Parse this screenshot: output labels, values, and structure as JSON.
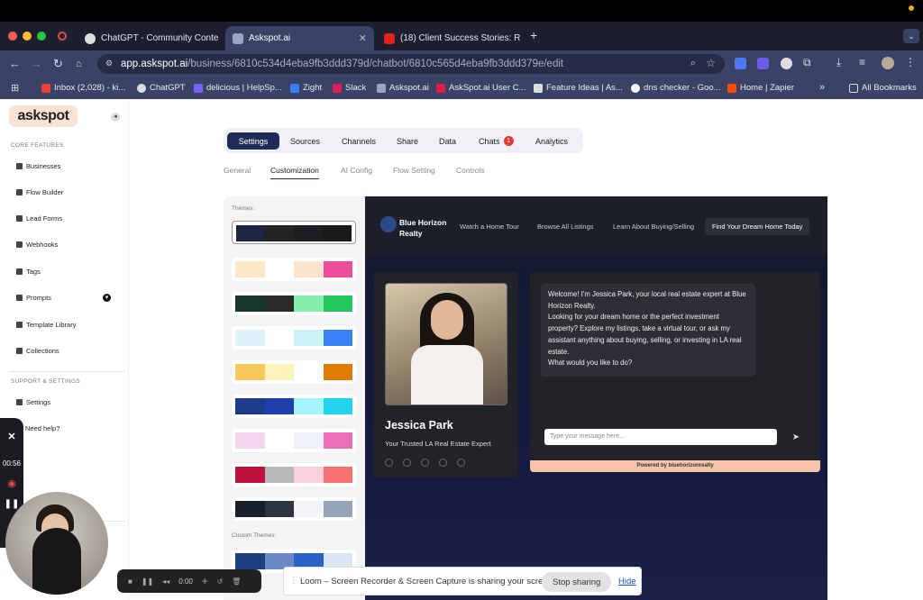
{
  "browser": {
    "tabs": [
      {
        "label": "ChatGPT - Community Conte"
      },
      {
        "label": "Askspot.ai"
      },
      {
        "label": "(18) Client Success Stories: R"
      }
    ],
    "url_host": "app.askspot.ai",
    "url_path": "/business/6810c534d4eba9fb3ddd379d/chatbot/6810c565d4eba9fb3ddd379e/edit",
    "bookmarks": [
      "Inbox (2,028) - ki...",
      "ChatGPT",
      "delicious | HelpSp...",
      "Zight",
      "Slack",
      "Askspot.ai",
      "AskSpot.ai User C...",
      "Feature Ideas | As...",
      "dns checker - Goo...",
      "Home | Zapier",
      "All Bookmarks"
    ]
  },
  "sidebar": {
    "logo": "askspot",
    "core_header": "CORE FEATURES",
    "core_items": [
      "Businesses",
      "Flow Builder",
      "Lead Forms",
      "Webhooks",
      "Tags",
      "Prompts",
      "Template Library",
      "Collections"
    ],
    "support_header": "SUPPORT & SETTINGS",
    "support_items": [
      "Settings",
      "Need help?"
    ]
  },
  "main": {
    "tabs": [
      "Settings",
      "Sources",
      "Channels",
      "Share",
      "Data",
      "Chats",
      "Analytics"
    ],
    "chats_badge": "1",
    "subtabs": [
      "General",
      "Customization",
      "AI Config",
      "Flow Setting",
      "Controls"
    ],
    "themes_label": "Themes:",
    "custom_themes_label": "Custom Themes:",
    "themes": [
      [
        "#1d2540",
        "#232323",
        "#1e1e22",
        "#1a1a1c"
      ],
      [
        "#fde9c8",
        "#ffffff",
        "#fde4cf",
        "#ee4d9b"
      ],
      [
        "#15382a",
        "#2a2a2a",
        "#86efac",
        "#22c55e"
      ],
      [
        "#dff1fb",
        "#ffffff",
        "#cbf3fb",
        "#3b82f6"
      ],
      [
        "#f7c85b",
        "#fef3b8",
        "#ffffff",
        "#e07b00"
      ],
      [
        "#1e3a8a",
        "#1e40af",
        "#a5f3fc",
        "#22d3ee"
      ],
      [
        "#f4d6ee",
        "#ffffff",
        "#eef0fb",
        "#ee6fb5"
      ],
      [
        "#be123c",
        "#b9b9b9",
        "#fbd0dc",
        "#f87171"
      ],
      [
        "#1a1f2c",
        "#2d3341",
        "#f1f3f6",
        "#94a3b8"
      ],
      [
        "#1d3f7d",
        "#6b87c4",
        "#2a63c8",
        "#dbe6f5"
      ]
    ]
  },
  "preview": {
    "brand": "Blue Horizon Realty",
    "nav_links": [
      "Watch a Home Tour",
      "Browse All Listings",
      "Learn About Buying/Selling"
    ],
    "cta": "Find Your Dream Home Today",
    "agent_name": "Jessica Park",
    "agent_tagline": "Your Trusted LA Real Estate Expert",
    "welcome_message": "Welcome! I'm Jessica Park, your local real estate expert at Blue Horizon Realty.\nLooking for your dream home or the perfect investment property? Explore my listings, take a virtual tour, or ask my assistant anything about buying, selling, or investing in LA real estate.\nWhat would you like to do?",
    "input_placeholder": "Type your message here...",
    "powered_by": "Powered by bluehorizonrealty"
  },
  "loom": {
    "timer": "00:56",
    "control_time": "0:00",
    "share_text": "Loom – Screen Recorder & Screen Capture is sharing your screen.",
    "stop_label": "Stop sharing",
    "hide_label": "Hide"
  }
}
